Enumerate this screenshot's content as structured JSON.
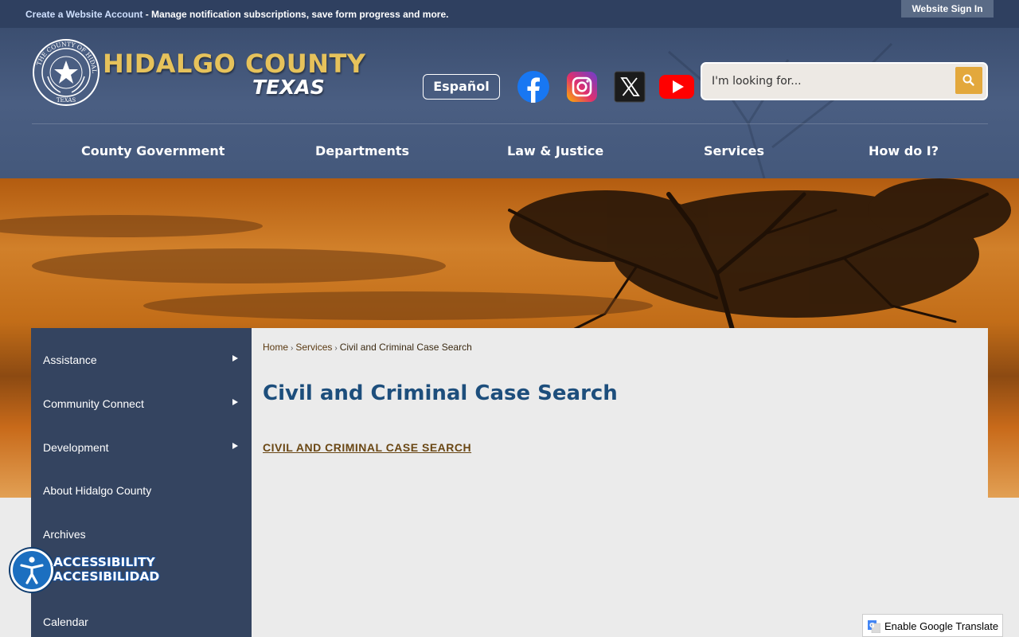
{
  "topbar": {
    "account_link": "Create a Website Account",
    "account_desc": " - Manage notification subscriptions, save form progress and more.",
    "signin": "Website Sign In"
  },
  "header": {
    "brand_main": "HIDALGO COUNTY",
    "brand_sub": "TEXAS",
    "seal_text": "THE COUNTY OF HIDALGO TEXAS",
    "espanol": "Español",
    "social": [
      "facebook-icon",
      "instagram-icon",
      "x-icon",
      "youtube-icon"
    ],
    "search_placeholder": "I'm looking for..."
  },
  "nav": [
    "County Government",
    "Departments",
    "Law & Justice",
    "Services",
    "How do I?"
  ],
  "sidebar": {
    "items": [
      {
        "label": "Assistance",
        "has_submenu": true
      },
      {
        "label": "Community Connect",
        "has_submenu": true
      },
      {
        "label": "Development",
        "has_submenu": true
      },
      {
        "label": "About Hidalgo County",
        "has_submenu": false
      },
      {
        "label": "Archives",
        "has_submenu": false
      },
      {
        "label": "",
        "has_submenu": false
      },
      {
        "label": "Calendar",
        "has_submenu": false
      }
    ]
  },
  "content": {
    "breadcrumb": [
      "Home",
      "Services",
      "Civil and Criminal Case Search"
    ],
    "title": "Civil and Criminal Case Search",
    "link": " CIVIL AND CRIMINAL CASE SEARCH"
  },
  "accessibility": {
    "line1": "ACCESSIBILITY",
    "line2": "ACCESIBILIDAD"
  },
  "translate": {
    "label": "Enable Google Translate"
  },
  "colors": {
    "topbar": "#2f4060",
    "header": "#44587b",
    "brand_gold": "#e6c25b",
    "sidebar": "#344460",
    "title_blue": "#1d4e7c",
    "search_button": "#e3a83c"
  }
}
